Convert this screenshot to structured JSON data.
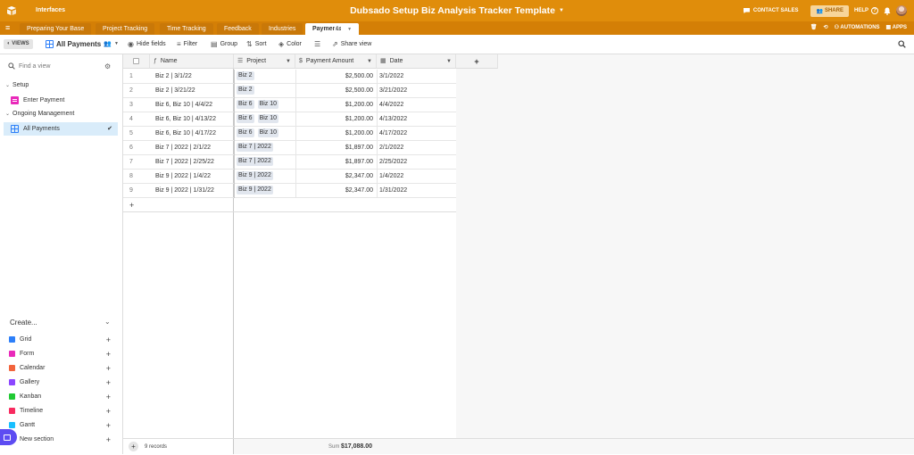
{
  "topbar": {
    "interfaces_label": "Interfaces",
    "base_title": "Dubsado Setup Biz Analysis Tracker Template",
    "contact_sales": "CONTACT SALES",
    "share": "SHARE",
    "help": "HELP",
    "brand_color": "#e08d0b"
  },
  "tabs": [
    {
      "label": "Preparing Your Base"
    },
    {
      "label": "Project Tracking"
    },
    {
      "label": "Time Tracking"
    },
    {
      "label": "Feedback"
    },
    {
      "label": "Industries"
    },
    {
      "label": "Payments",
      "active": true
    }
  ],
  "tabs_right": {
    "automations": "AUTOMATIONS",
    "apps": "APPS"
  },
  "toolbar": {
    "views": "VIEWS",
    "view_name": "All Payments",
    "hide_fields": "Hide fields",
    "filter": "Filter",
    "group": "Group",
    "sort": "Sort",
    "color": "Color",
    "share_view": "Share view"
  },
  "sidebar": {
    "find_placeholder": "Find a view",
    "sections": [
      {
        "title": "Setup",
        "items": [
          {
            "label": "Enter Payment",
            "icon": "form-icon"
          }
        ]
      },
      {
        "title": "Ongoing Management",
        "items": [
          {
            "label": "All Payments",
            "icon": "grid-icon",
            "active": true
          }
        ]
      }
    ],
    "create_label": "Create...",
    "create_items": [
      {
        "label": "Grid",
        "color": "#2d7ff9"
      },
      {
        "label": "Form",
        "color": "#e929ba"
      },
      {
        "label": "Calendar",
        "color": "#f2643c"
      },
      {
        "label": "Gallery",
        "color": "#8b46ff"
      },
      {
        "label": "Kanban",
        "color": "#20c933"
      },
      {
        "label": "Timeline",
        "color": "#f82b60"
      },
      {
        "label": "Gantt",
        "color": "#18bfff"
      },
      {
        "label": "New section",
        "color": ""
      }
    ]
  },
  "table": {
    "columns": {
      "name": "Name",
      "project": "Project",
      "amount": "Payment Amount",
      "date": "Date"
    },
    "rows": [
      {
        "num": "1",
        "name": "Biz 2 | 3/1/22",
        "project": [
          "Biz 2"
        ],
        "amount": "$2,500.00",
        "date": "3/1/2022"
      },
      {
        "num": "2",
        "name": "Biz 2 | 3/21/22",
        "project": [
          "Biz 2"
        ],
        "amount": "$2,500.00",
        "date": "3/21/2022"
      },
      {
        "num": "3",
        "name": "Biz 6, Biz 10 | 4/4/22",
        "project": [
          "Biz 6",
          "Biz 10"
        ],
        "amount": "$1,200.00",
        "date": "4/4/2022"
      },
      {
        "num": "4",
        "name": "Biz 6, Biz 10 | 4/13/22",
        "project": [
          "Biz 6",
          "Biz 10"
        ],
        "amount": "$1,200.00",
        "date": "4/13/2022"
      },
      {
        "num": "5",
        "name": "Biz 6, Biz 10 | 4/17/22",
        "project": [
          "Biz 6",
          "Biz 10"
        ],
        "amount": "$1,200.00",
        "date": "4/17/2022"
      },
      {
        "num": "6",
        "name": "Biz 7 | 2022 | 2/1/22",
        "project": [
          "Biz 7 | 2022"
        ],
        "amount": "$1,897.00",
        "date": "2/1/2022"
      },
      {
        "num": "7",
        "name": "Biz 7 | 2022 | 2/25/22",
        "project": [
          "Biz 7 | 2022"
        ],
        "amount": "$1,897.00",
        "date": "2/25/2022"
      },
      {
        "num": "8",
        "name": "Biz 9 | 2022 | 1/4/22",
        "project": [
          "Biz 9 | 2022"
        ],
        "amount": "$2,347.00",
        "date": "1/4/2022"
      },
      {
        "num": "9",
        "name": "Biz 9 | 2022 | 1/31/22",
        "project": [
          "Biz 9 | 2022"
        ],
        "amount": "$2,347.00",
        "date": "1/31/2022"
      }
    ],
    "record_count": "9 records",
    "sum_label": "Sum",
    "sum_value": "$17,088.00"
  }
}
